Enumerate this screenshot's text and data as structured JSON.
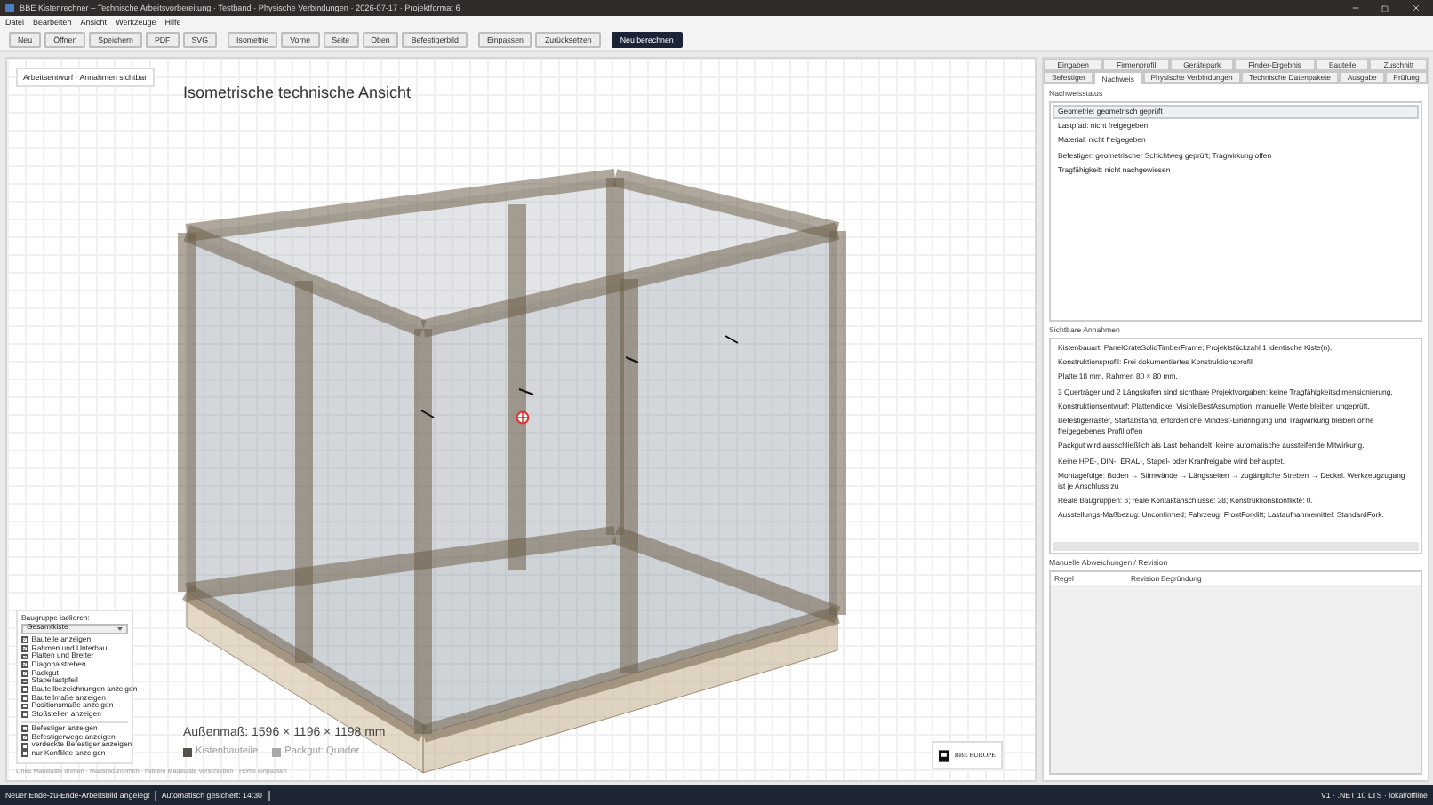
{
  "window": {
    "title": "BBE Kistenrechner – Technische Arbeitsvorbereitung · Testband · Physische Verbindungen · 2026-07-17 · Projektformat 6"
  },
  "menu": [
    "Datei",
    "Bearbeiten",
    "Ansicht",
    "Werkzeuge",
    "Hilfe"
  ],
  "toolbar": [
    {
      "buttons": [
        {
          "label": "Neu",
          "kind": "normal"
        },
        {
          "label": "Öffnen",
          "kind": "normal"
        },
        {
          "label": "Speichern",
          "kind": "normal"
        },
        {
          "label": "PDF",
          "kind": "normal"
        },
        {
          "label": "SVG",
          "kind": "normal"
        }
      ]
    },
    {
      "buttons": [
        {
          "label": "Isometrie",
          "kind": "normal"
        },
        {
          "label": "Vorne",
          "kind": "normal"
        },
        {
          "label": "Seite",
          "kind": "normal"
        },
        {
          "label": "Oben",
          "kind": "normal"
        },
        {
          "label": "Befestigerbild",
          "kind": "normal"
        }
      ]
    },
    {
      "buttons": [
        {
          "label": "Einpassen",
          "kind": "normal"
        },
        {
          "label": "Zurücksetzen",
          "kind": "normal"
        }
      ]
    },
    {
      "buttons": [
        {
          "label": "Neu berechnen",
          "kind": "primary"
        }
      ]
    }
  ],
  "canvas": {
    "badge": "Arbeitsentwurf · Annahmen sichtbar",
    "title": "Isometrische technische Ansicht",
    "view_options": {
      "label": "Baugruppe isolieren:",
      "dropdown": "Gesamtkiste",
      "groups": [
        {
          "items": [
            {
              "label": "Bauteile anzeigen",
              "checked": true
            },
            {
              "label": "Rahmen und Unterbau",
              "checked": true
            },
            {
              "label": "Platten und Bretter",
              "checked": true
            },
            {
              "label": "Diagonalstreben",
              "checked": true
            },
            {
              "label": "Packgut",
              "checked": true
            },
            {
              "label": "Stapellastpfeil",
              "checked": false
            },
            {
              "label": "Bauteilbezeichnungen anzeigen",
              "checked": false
            },
            {
              "label": "Bauteilmaße anzeigen",
              "checked": false
            },
            {
              "label": "Positionsmaße anzeigen",
              "checked": false
            },
            {
              "label": "Stoßstellen anzeigen",
              "checked": false
            }
          ]
        },
        {
          "items": [
            {
              "label": "Befestiger anzeigen",
              "checked": true
            },
            {
              "label": "Befestigerwege anzeigen",
              "checked": true
            },
            {
              "label": "verdeckte Befestiger anzeigen",
              "checked": false
            },
            {
              "label": "nur Konflikte anzeigen",
              "checked": false
            }
          ]
        }
      ]
    },
    "dimensions": "Außenmaß: 1596 × 1196 × 1198 mm",
    "legend": [
      {
        "label": "Kistenbauteile",
        "color": "#55504a"
      },
      {
        "label": "Packgut: Quader",
        "color": "#a8a8a8"
      }
    ],
    "hint": "Linke Maustaste drehen · Mausrad zoomen · mittlere Maustaste verschieben · Home einpassen",
    "logo": "BBE EUROPE"
  },
  "tab_rows": [
    [
      {
        "label": "Eingaben",
        "selected": false
      },
      {
        "label": "Firmenprofil",
        "selected": false
      },
      {
        "label": "Gerätepark",
        "selected": false
      },
      {
        "label": "Finder-Ergebnis",
        "selected": false
      },
      {
        "label": "Bauteile",
        "selected": false
      },
      {
        "label": "Zuschnitt",
        "selected": false
      }
    ],
    [
      {
        "label": "Befestiger",
        "selected": false
      },
      {
        "label": "Nachweis",
        "selected": true
      },
      {
        "label": "Physische Verbindungen",
        "selected": false
      },
      {
        "label": "Technische Datenpakete",
        "selected": false
      },
      {
        "label": "Ausgabe",
        "selected": false
      },
      {
        "label": "Prüfung",
        "selected": false
      }
    ]
  ],
  "nachweisstatus": {
    "title": "Nachweisstatus",
    "items": [
      {
        "label": "Geometrie: geometrisch geprüft",
        "selected": true
      },
      {
        "label": "Lastpfad: nicht freigegeben",
        "selected": false
      },
      {
        "label": "Material: nicht freigegeben",
        "selected": false
      },
      {
        "label": "Befestiger: geometrischer Schichtweg geprüft; Tragwirkung offen",
        "selected": false
      },
      {
        "label": "Tragfähigkeit: nicht nachgewiesen",
        "selected": false
      }
    ]
  },
  "annahmen": {
    "title": "Sichtbare Annahmen",
    "items": [
      "Kistenbauart: PanelCrateSolidTimberFrame; Projektstückzahl 1 identische Kiste(n).",
      "Konstruktionsprofil: Frei dokumentiertes Konstruktionsprofil",
      "Platte 18 mm, Rahmen 80 × 80 mm.",
      "3 Querträger und 2 Längskufen sind sichtbare Projektvorgaben; keine Tragfähigkeitsdimensionierung.",
      "Konstruktionsentwurf: Plattendicke: VisibleBestAssumption; manuelle Werte bleiben ungeprüft.",
      "Befestigerraster, Startabstand, erforderliche Mindest-Eindringung und Tragwirkung bleiben ohne freigegebenes Profil offen",
      "Packgut wird ausschließlich als Last behandelt; keine automatische aussteifende Mitwirkung.",
      "Keine HPE-, DIN-, ERAL-, Stapel- oder Kranfreigabe wird behauptet.",
      "Montagefolge: Boden → Stirnwände → Längsseiten → zugängliche Streben → Deckel. Werkzeugzugang ist je Anschluss zu",
      "Reale Baugruppen: 6; reale Kontaktanschlüsse: 28; Konstruktionskonflikte: 0.",
      "Ausstellungs-Maßbezug: Unconfirmed; Fahrzeug: FrontForklift; Lastaufnahmemittel: StandardFork."
    ]
  },
  "revision": {
    "title": "Manuelle Abweichungen / Revision",
    "columns": [
      "Regel",
      "Revision",
      "Begründung"
    ]
  },
  "status_bar": {
    "left": [
      "Neuer Ende-zu-Ende-Arbeitsbild angelegt",
      "Automatisch gesichert: 14:30"
    ],
    "right": "V1 · .NET 10 LTS · lokal/offline"
  }
}
